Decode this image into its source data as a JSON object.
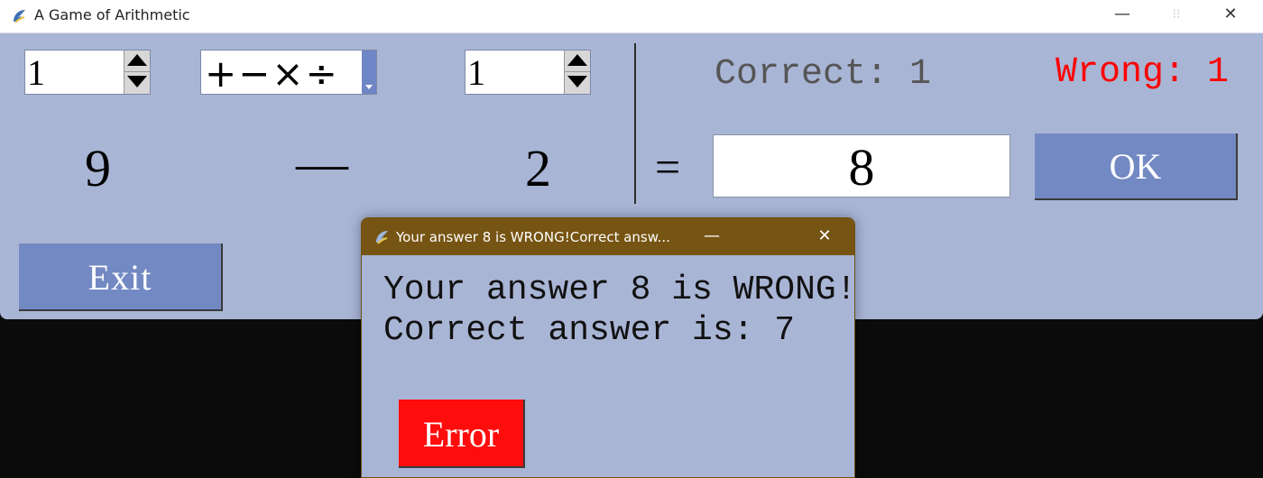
{
  "window": {
    "title": "A Game of Arithmetic",
    "minimize_glyph": "—",
    "maximize_glyph": "⁝⁝",
    "close_glyph": "✕"
  },
  "controls": {
    "left_spinbox_value": "1",
    "operator_combo_value": "+−×÷",
    "right_spinbox_value": "1"
  },
  "problem": {
    "operand1": "9",
    "operator": "—",
    "operand2": "2",
    "equals": "="
  },
  "score": {
    "correct_label": "Correct: 1",
    "wrong_label": "Wrong: 1"
  },
  "answer_input_value": "8",
  "buttons": {
    "ok_label": "OK",
    "exit_label": "Exit"
  },
  "dialog": {
    "title": "Your answer 8 is WRONG!Correct answ...",
    "line1": "Your answer 8 is WRONG!",
    "line2": "Correct answer is: 7",
    "error_button_label": "Error",
    "minimize_glyph": "—",
    "close_glyph": "✕"
  },
  "colors": {
    "window_bg": "#a9b5d5",
    "button_bg": "#7389c3",
    "wrong_text": "#ff0000",
    "correct_text": "#555555",
    "dialog_titlebar": "#765413",
    "error_button": "#ff0d0d"
  },
  "icons": [
    "python-feather-icon",
    "spin-up-arrow-icon",
    "spin-down-arrow-icon",
    "dropdown-arrow-icon"
  ]
}
